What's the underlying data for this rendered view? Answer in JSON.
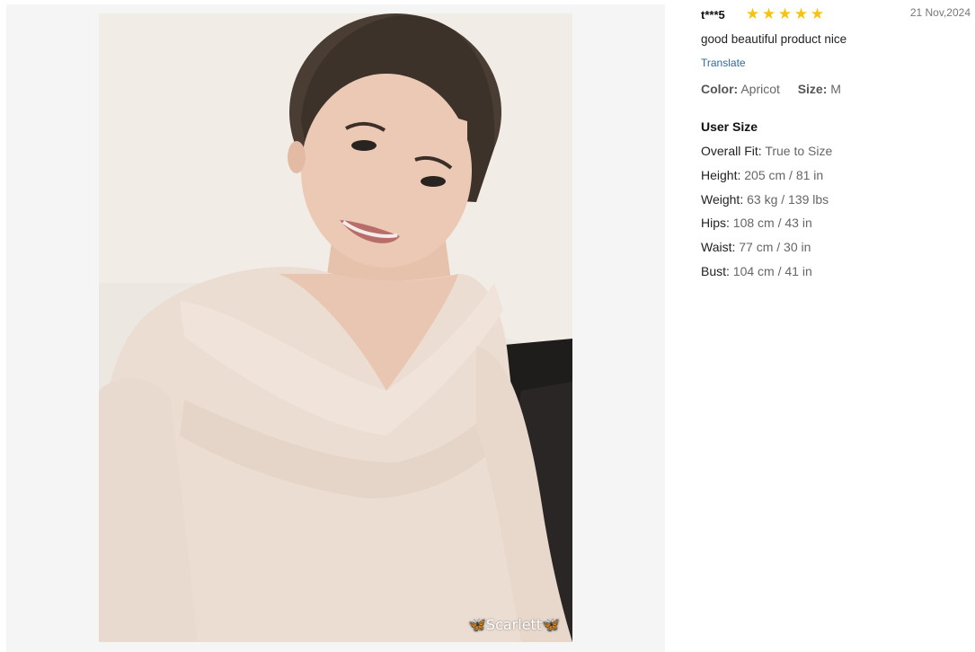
{
  "review": {
    "user": "t***5",
    "rating": 5,
    "star_glyph": "★",
    "star_color": "#f6c311",
    "date": "21 Nov,2024",
    "text": "good beautiful product nice",
    "translate": "Translate",
    "color_label": "Color:",
    "color_value": "Apricot",
    "size_label": "Size:",
    "size_value": "M",
    "user_size_title": "User Size",
    "measurements": [
      {
        "label": "Overall Fit:",
        "value": "True to Size"
      },
      {
        "label": "Height:",
        "value": "205 cm / 81 in"
      },
      {
        "label": "Weight:",
        "value": "63 kg / 139 lbs"
      },
      {
        "label": "Hips:",
        "value": "108 cm / 43 in"
      },
      {
        "label": "Waist:",
        "value": "77 cm / 30 in"
      },
      {
        "label": "Bust:",
        "value": "104 cm / 41 in"
      }
    ]
  },
  "photo": {
    "watermark": "🦋Scarlett🦋"
  }
}
